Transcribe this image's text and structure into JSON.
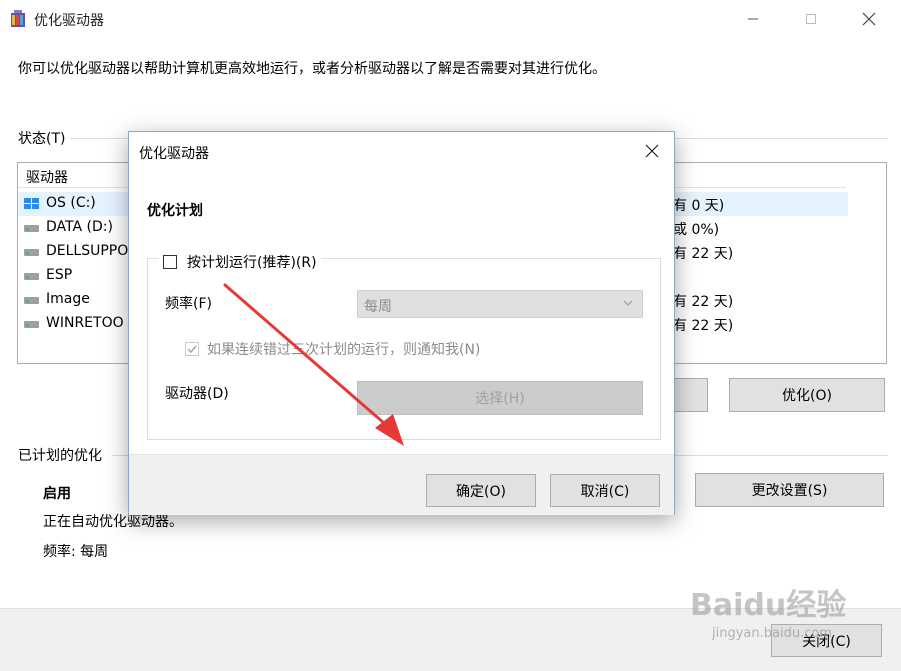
{
  "main": {
    "title": "优化驱动器",
    "description": "你可以优化驱动器以帮助计算机更高效地运行，或者分析驱动器以了解是否需要对其进行优化。",
    "status_label": "状态(T)",
    "list_header_drive": "驱动器",
    "drives": [
      {
        "name": "OS (C:)",
        "status": "有 0 天)"
      },
      {
        "name": "DATA (D:)",
        "status": "或 0%)"
      },
      {
        "name": "DELLSUPPO",
        "status": "有 22 天)"
      },
      {
        "name": "ESP",
        "status": ""
      },
      {
        "name": "Image",
        "status": "有 22 天)"
      },
      {
        "name": "WINRETOO",
        "status": "有 22 天)"
      }
    ],
    "optimize_button": "优化(O)",
    "scheduled_label": "已计划的优化",
    "schedule_state": "启用",
    "schedule_desc": "正在自动优化驱动器。",
    "schedule_freq": "频率: 每周",
    "change_settings_button": "更改设置(S)",
    "close_button": "关闭(C)"
  },
  "dialog": {
    "title": "优化驱动器",
    "heading": "优化计划",
    "run_on_schedule": "按计划运行(推荐)(R)",
    "frequency_label": "频率(F)",
    "frequency_value": "每周",
    "notify_label": "如果连续错过三次计划的运行，则通知我(N)",
    "drives_label": "驱动器(D)",
    "select_button": "选择(H)",
    "ok_button": "确定(O)",
    "cancel_button": "取消(C)"
  },
  "watermark": {
    "logo": "Baidu经验",
    "url": "jingyan.baidu.com"
  },
  "colors": {
    "annotation_arrow": "#e53935",
    "selection": "#e5f3ff"
  }
}
